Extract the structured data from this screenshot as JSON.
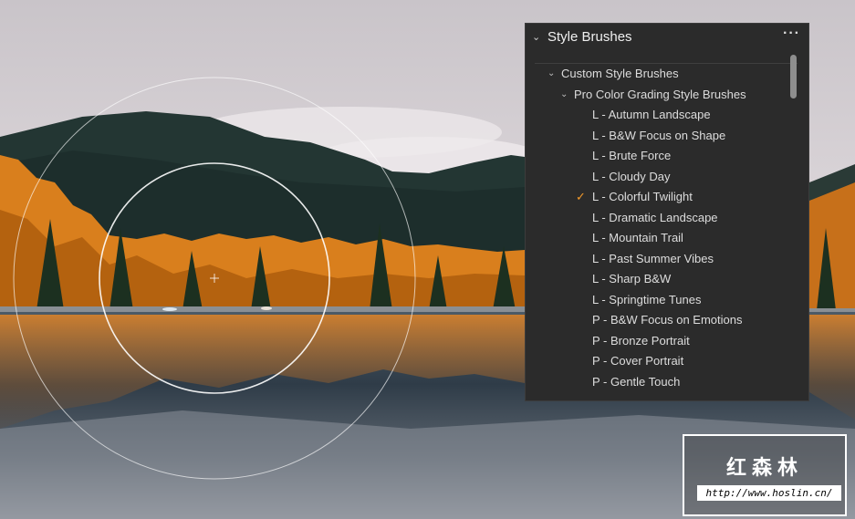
{
  "panel": {
    "title": "Style Brushes",
    "more_label": "···",
    "group": {
      "label": "Custom Style Brushes",
      "subgroup": {
        "label": "Pro Color Grading Style Brushes",
        "items": [
          {
            "label": "L - Autumn Landscape",
            "selected": false
          },
          {
            "label": "L - B&W Focus on Shape",
            "selected": false
          },
          {
            "label": "L - Brute Force",
            "selected": false
          },
          {
            "label": "L - Cloudy Day",
            "selected": false
          },
          {
            "label": "L - Colorful Twilight",
            "selected": true
          },
          {
            "label": "L - Dramatic Landscape",
            "selected": false
          },
          {
            "label": "L - Mountain Trail",
            "selected": false
          },
          {
            "label": "L - Past Summer Vibes",
            "selected": false
          },
          {
            "label": "L - Sharp B&W",
            "selected": false
          },
          {
            "label": "L - Springtime Tunes",
            "selected": false
          },
          {
            "label": "P - B&W Focus on Emotions",
            "selected": false
          },
          {
            "label": "P - Bronze Portrait",
            "selected": false
          },
          {
            "label": "P - Cover Portrait",
            "selected": false
          },
          {
            "label": "P - Gentle Touch",
            "selected": false
          }
        ]
      }
    },
    "check_mark": "✓"
  },
  "watermark": {
    "chinese_text": "红森林",
    "url": "http://www.hoslin.cn/"
  },
  "colors": {
    "accent_check": "#f39a2b",
    "panel_bg": "#2b2b2b"
  },
  "icons": {
    "panel_collapse": "chevron-down-icon",
    "group_expand": "chevron-down-icon",
    "more": "more-horizontal-icon",
    "brush_cursor": "brush-cursor-icon"
  }
}
